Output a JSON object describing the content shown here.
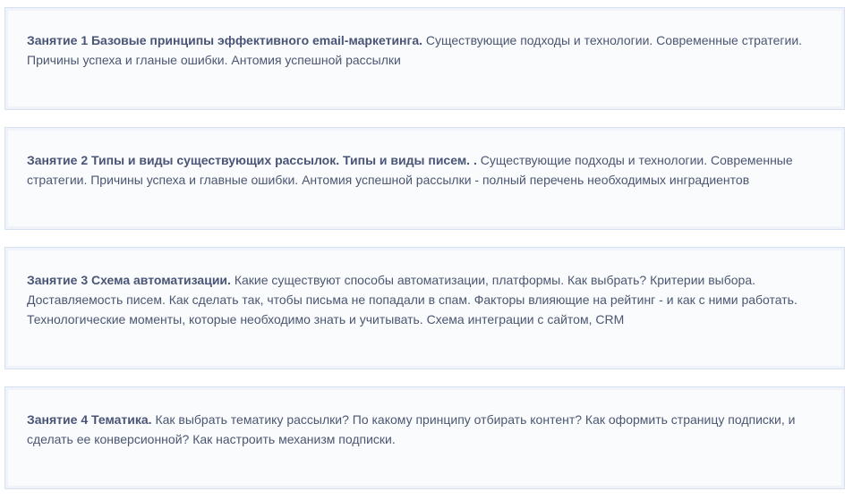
{
  "lessons": [
    {
      "title": "Занятие 1 Базовые принципы эффективного email-маркетинга.",
      "text": " Существующие подходы и технологии.  Современные стратегии. Причины успеха и гланые ошибки. Антомия успешной рассылки"
    },
    {
      "title": "Занятие 2 Типы и виды существующих рассылок. Типы и виды писем. .",
      "text": " Существующие подходы и технологии.  Современные стратегии. Причины успеха и главные ошибки. Антомия успешной рассылки - полный перечень необходимых инградиентов"
    },
    {
      "title": "Занятие 3 Схема автоматизации.",
      "text": "  Какие существуют способы автоматизации, платформы. Как выбрать? Критерии выбора. Доставляемость писем. Как сделать так, чтобы письма не попадали в спам.  Факторы влияющие на рейтинг - и как с ними работать.  Технологические моменты, которые необходимо знать и учитывать. Схема интеграции с сайтом, CRM"
    },
    {
      "title": "Занятие 4 Тематика.",
      "text": "  Как выбрать тематику рассылки? По какому принципу отбирать контент? Как оформить страницу подписки, и сделать ее конверсионной? Как настроить механизм подписки."
    }
  ]
}
